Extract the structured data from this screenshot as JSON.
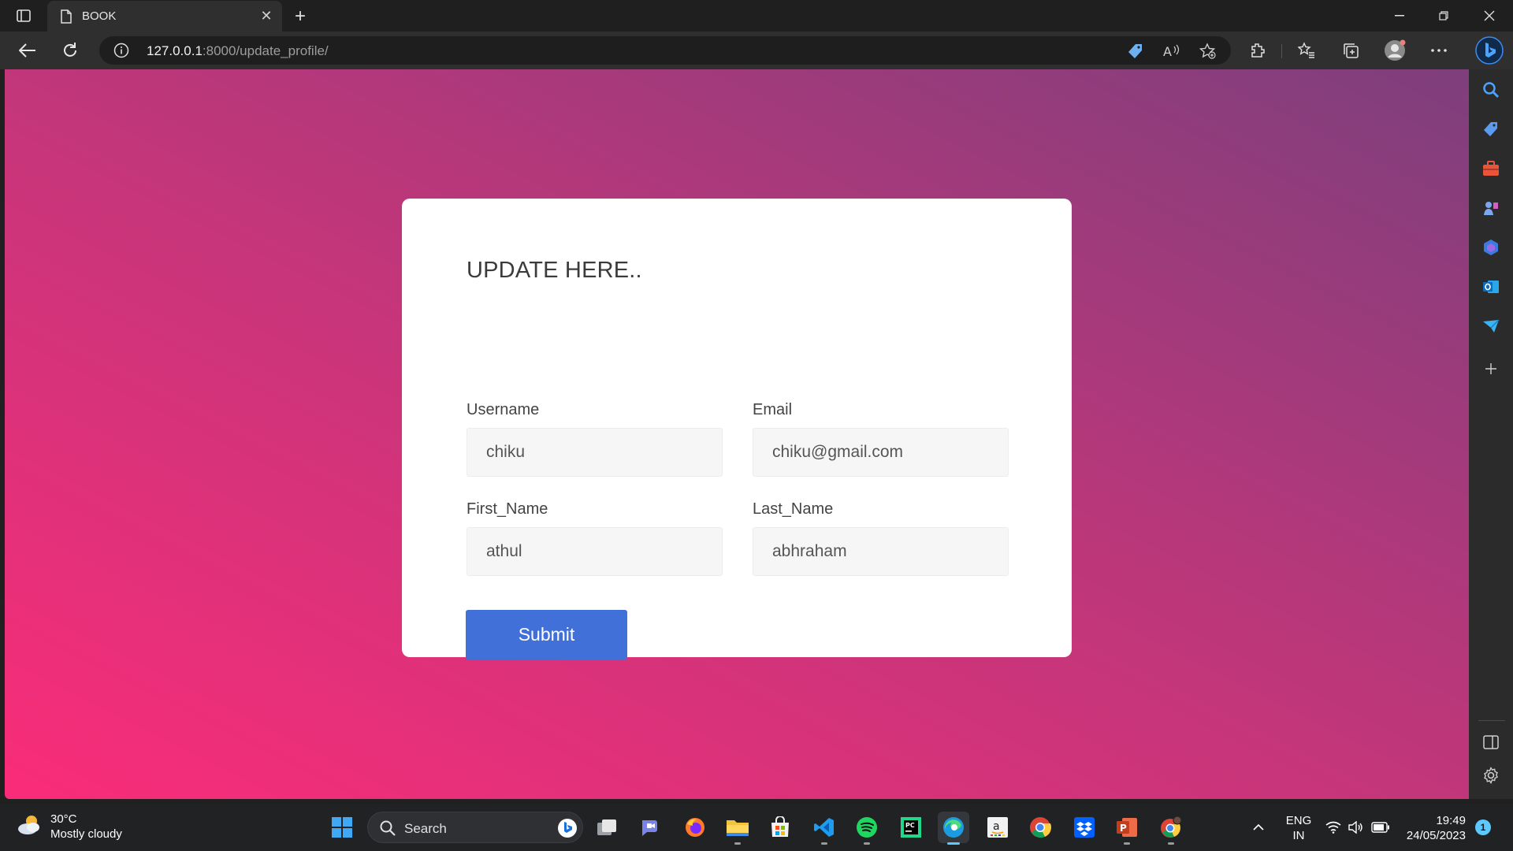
{
  "browser": {
    "tab_title": "BOOK",
    "url_host": "127.0.0.1",
    "url_rest": ":8000/update_profile/"
  },
  "form": {
    "heading": "UPDATE HERE..",
    "fields": [
      {
        "label": "Username",
        "value": "chiku"
      },
      {
        "label": "Email",
        "value": "chiku@gmail.com"
      },
      {
        "label": "First_Name",
        "value": "athul"
      },
      {
        "label": "Last_Name",
        "value": "abhraham"
      }
    ],
    "submit_label": "Submit"
  },
  "taskbar": {
    "weather_temp": "30°C",
    "weather_desc": "Mostly cloudy",
    "search_label": "Search",
    "lang_top": "ENG",
    "lang_bottom": "IN",
    "time": "19:49",
    "date": "24/05/2023",
    "notification_count": "1"
  },
  "colors": {
    "gradient_start": "#fa2c79",
    "gradient_end": "#7e3f7c",
    "submit_button": "#4170d8"
  }
}
